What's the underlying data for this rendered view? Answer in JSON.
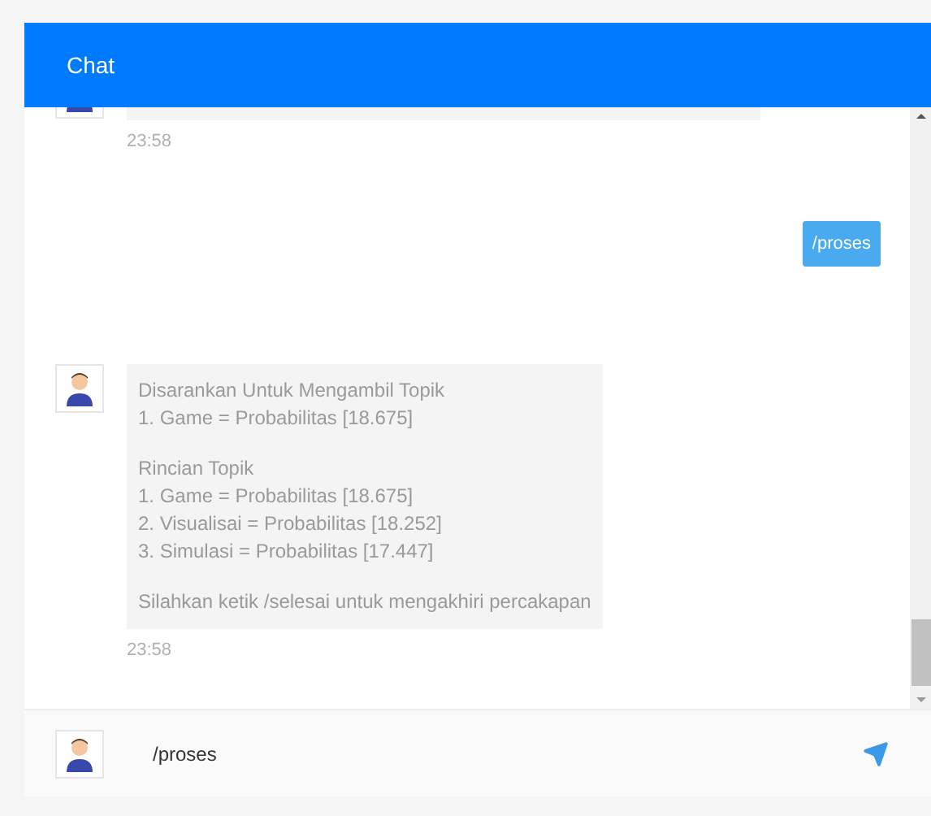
{
  "header": {
    "title": "Chat"
  },
  "messages": [
    {
      "kind": "bot",
      "time": "23:58"
    },
    {
      "kind": "user",
      "text": "/proses"
    },
    {
      "kind": "bot",
      "time": "23:58",
      "paragraphs": [
        [
          "Disarankan Untuk Mengambil Topik",
          "1. Game = Probabilitas [18.675]"
        ],
        [
          "Rincian Topik",
          "1. Game = Probabilitas [18.675]",
          "2. Visualisai = Probabilitas [18.252]",
          "3. Simulasi = Probabilitas [17.447]"
        ],
        [
          "Silahkan ketik /selesai untuk mengakhiri percakapan"
        ]
      ]
    }
  ],
  "composer": {
    "value": "/proses"
  }
}
